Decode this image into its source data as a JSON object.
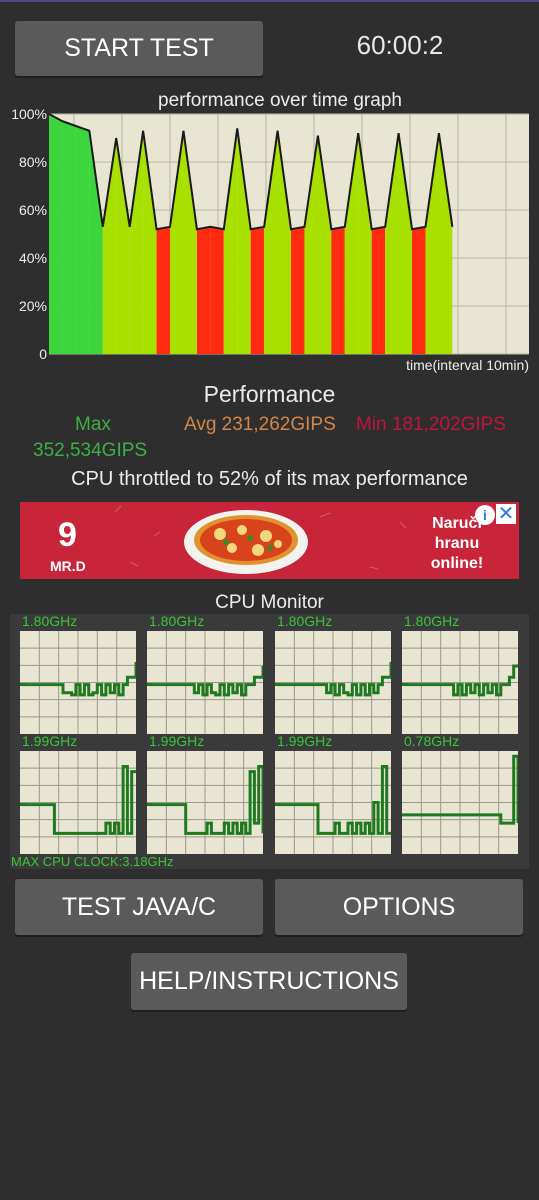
{
  "header": {
    "start_button": "START TEST",
    "timer": "60:00:2"
  },
  "graph": {
    "title": "performance over time graph",
    "y_ticks": [
      "100%",
      "80%",
      "60%",
      "40%",
      "20%",
      "0"
    ],
    "x_caption": "time(interval 10min)",
    "colors": {
      "background": "#e8e6d2",
      "high": "#3cd63c",
      "throttled": "#ff2a10",
      "spike": "#a8e000",
      "line": "#1a1a1a"
    }
  },
  "chart_data": {
    "type": "area",
    "title": "performance over time graph",
    "xlabel": "time(interval 10min)",
    "ylabel": "",
    "ylim": [
      0,
      100
    ],
    "y_ticks": [
      "0",
      "20%",
      "40%",
      "60%",
      "80%",
      "100%"
    ],
    "grid": true,
    "x": [
      0,
      2,
      4,
      6,
      8,
      10,
      12,
      14,
      16,
      18,
      20,
      22,
      24,
      26,
      28,
      30,
      32,
      34,
      36,
      38,
      40,
      42,
      44,
      46,
      48,
      50,
      52,
      54,
      56,
      58,
      60
    ],
    "series": [
      {
        "values": [
          100,
          97,
          95,
          93,
          53,
          90,
          53,
          93,
          52,
          53,
          93,
          52,
          53,
          52,
          94,
          52,
          53,
          93,
          52,
          53,
          91,
          52,
          53,
          92,
          52,
          53,
          92,
          52,
          53,
          92,
          53
        ]
      }
    ]
  },
  "performance": {
    "title": "Performance",
    "max_label": "Max",
    "max_value": "352,534GIPS",
    "avg": "Avg 231,262GIPS",
    "min": "Min 181,202GIPS",
    "throttle_text": "CPU throttled to 52% of its max performance"
  },
  "ad": {
    "logo_number": "9",
    "logo_text": "MR.D",
    "cta": "Naruči hranu online!",
    "info_icon": "info-icon",
    "close_icon": "close-icon"
  },
  "cpu_monitor": {
    "title": "CPU Monitor",
    "cores": [
      {
        "freq": "1.80GHz",
        "levels": [
          0.48,
          0.48,
          0.48,
          0.48,
          0.48,
          0.48,
          0.48,
          0.48,
          0.48,
          0.48,
          0.4,
          0.4,
          0.38,
          0.48,
          0.38,
          0.48,
          0.38,
          0.4,
          0.48,
          0.38,
          0.48,
          0.4,
          0.48,
          0.38,
          0.48,
          0.55,
          0.55,
          0.7
        ]
      },
      {
        "freq": "1.80GHz",
        "levels": [
          0.48,
          0.48,
          0.48,
          0.48,
          0.48,
          0.48,
          0.48,
          0.48,
          0.48,
          0.48,
          0.48,
          0.4,
          0.48,
          0.38,
          0.48,
          0.4,
          0.38,
          0.48,
          0.38,
          0.48,
          0.4,
          0.48,
          0.38,
          0.48,
          0.48,
          0.55,
          0.55,
          0.66
        ]
      },
      {
        "freq": "1.80GHz",
        "levels": [
          0.48,
          0.48,
          0.48,
          0.48,
          0.48,
          0.48,
          0.48,
          0.48,
          0.48,
          0.48,
          0.48,
          0.48,
          0.4,
          0.48,
          0.38,
          0.48,
          0.4,
          0.38,
          0.48,
          0.38,
          0.48,
          0.38,
          0.48,
          0.4,
          0.48,
          0.55,
          0.55,
          0.7
        ]
      },
      {
        "freq": "1.80GHz",
        "levels": [
          0.48,
          0.48,
          0.48,
          0.48,
          0.48,
          0.48,
          0.48,
          0.48,
          0.48,
          0.48,
          0.48,
          0.48,
          0.38,
          0.48,
          0.38,
          0.48,
          0.4,
          0.48,
          0.38,
          0.48,
          0.4,
          0.48,
          0.38,
          0.48,
          0.48,
          0.55,
          0.66,
          0.66
        ]
      },
      {
        "freq": "1.99GHz",
        "levels": [
          0.48,
          0.48,
          0.48,
          0.48,
          0.48,
          0.48,
          0.48,
          0.48,
          0.2,
          0.2,
          0.2,
          0.2,
          0.2,
          0.2,
          0.2,
          0.2,
          0.2,
          0.2,
          0.2,
          0.2,
          0.3,
          0.2,
          0.3,
          0.2,
          0.85,
          0.2,
          0.8,
          0.8
        ]
      },
      {
        "freq": "1.99GHz",
        "levels": [
          0.48,
          0.48,
          0.48,
          0.48,
          0.48,
          0.48,
          0.48,
          0.48,
          0.48,
          0.2,
          0.2,
          0.2,
          0.2,
          0.2,
          0.3,
          0.2,
          0.2,
          0.2,
          0.3,
          0.2,
          0.3,
          0.2,
          0.3,
          0.2,
          0.8,
          0.3,
          0.85,
          0.2
        ]
      },
      {
        "freq": "1.99GHz",
        "levels": [
          0.48,
          0.48,
          0.48,
          0.48,
          0.48,
          0.48,
          0.48,
          0.48,
          0.48,
          0.48,
          0.2,
          0.2,
          0.2,
          0.2,
          0.3,
          0.2,
          0.2,
          0.3,
          0.2,
          0.3,
          0.2,
          0.3,
          0.2,
          0.5,
          0.2,
          0.85,
          0.2,
          0.2
        ]
      },
      {
        "freq": "0.78GHz",
        "levels": [
          0.38,
          0.38,
          0.38,
          0.38,
          0.38,
          0.38,
          0.38,
          0.38,
          0.38,
          0.38,
          0.38,
          0.38,
          0.38,
          0.38,
          0.38,
          0.38,
          0.38,
          0.38,
          0.38,
          0.38,
          0.38,
          0.38,
          0.38,
          0.3,
          0.3,
          0.3,
          0.95,
          0.3
        ]
      }
    ],
    "max_clock": "MAX CPU CLOCK:3.18GHz"
  },
  "buttons": {
    "java": "TEST JAVA/C",
    "options": "OPTIONS",
    "help": "HELP/INSTRUCTIONS"
  }
}
